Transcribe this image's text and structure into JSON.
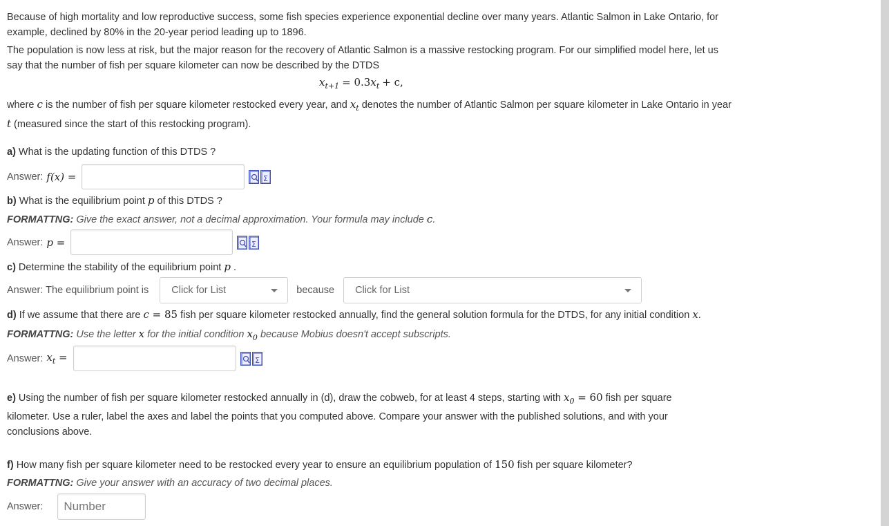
{
  "intro": {
    "p1": "Because of high mortality and low reproductive success, some fish species experience exponential decline over many years. Atlantic Salmon in Lake Ontario, for example, declined by 80% in the 20-year period leading up to 1896.",
    "p2": "The population is now less at risk, but the major reason for the recovery of Atlantic Salmon is a massive restocking program. For our simplified model here, let us say that the number of fish per square kilometer can now be described by the DTDS",
    "equation_lhs": "x",
    "equation_lhs_sub": "t+1",
    "equation_rhs_a": "= 0.3",
    "equation_rhs_x": "x",
    "equation_rhs_sub": "t",
    "equation_rhs_b": "+ c,",
    "where_1": "where ",
    "where_c": "c",
    "where_2": " is the number of fish per square kilometer restocked every year, and ",
    "where_x": "x",
    "where_sub": "t",
    "where_3": " denotes the number of Atlantic Salmon per square kilometer in Lake Ontario in year ",
    "where_t": "t",
    "where_4": " (measured since the start of this restocking program)."
  },
  "qa": {
    "label": "a)",
    "text": " What is the updating function of this DTDS ?",
    "answer_label": "Answer:",
    "answer_math": "f(x) =",
    "answer_value": ""
  },
  "qb": {
    "label": "b)",
    "text_1": " What is the equilibrium point ",
    "p": "p",
    "text_2": " of this DTDS ?",
    "fmt_label": "FORMATTNG:",
    "fmt_text": " Give the exact answer, not a decimal approximation. Your formula may include ",
    "fmt_c": "c",
    "fmt_end": ".",
    "answer_label": "Answer:",
    "answer_math": "p =",
    "answer_value": ""
  },
  "qc": {
    "label": "c)",
    "text_1": " Determine the stability of the equilibrium point ",
    "p": "p",
    "text_2": " .",
    "answer_label": "Answer: The equilibrium point is",
    "select1": "Click for List",
    "because": "because",
    "select2": "Click for List"
  },
  "qd": {
    "label": "d)",
    "text_1": " If we assume that there are ",
    "c": "c",
    "eq": " = 85",
    "text_2": " fish per square kilometer restocked annually, find the general solution formula for the DTDS, for any initial condition ",
    "x": "x",
    "text_3": ".",
    "fmt_label": "FORMATTNG:",
    "fmt_1": "  Use the letter ",
    "fmt_x": "x",
    "fmt_2": " for the initial condition ",
    "fmt_x0": "x",
    "fmt_x0sub": "0",
    "fmt_3": "  because Mobius doesn't accept subscripts.",
    "answer_label": "Answer:",
    "answer_math": "x",
    "answer_sub": "t",
    "answer_eq": " =",
    "answer_value": ""
  },
  "qe": {
    "label": "e)",
    "text_1": " Using the number of fish per square kilometer restocked annually in (d), draw the cobweb, for at least 4 steps, starting with ",
    "x0": "x",
    "x0sub": "0",
    "eq": " = 60",
    "text_2": " fish per square kilometer. Use a ruler, label the axes and label the points that you computed above.  Compare your answer with the published solutions, and with your conclusions above."
  },
  "qf": {
    "label": "f)",
    "text_1": " How many fish per square kilometer need to be restocked every year to ensure an equilibrium population of ",
    "num": "150",
    "text_2": " fish per square kilometer?",
    "fmt_label": "FORMATTNG:",
    "fmt_text": " Give your answer with an accuracy of two decimal places.",
    "answer_label": "Answer:",
    "placeholder": "Number"
  },
  "icons": [
    "preview-icon",
    "equation-editor-icon"
  ]
}
